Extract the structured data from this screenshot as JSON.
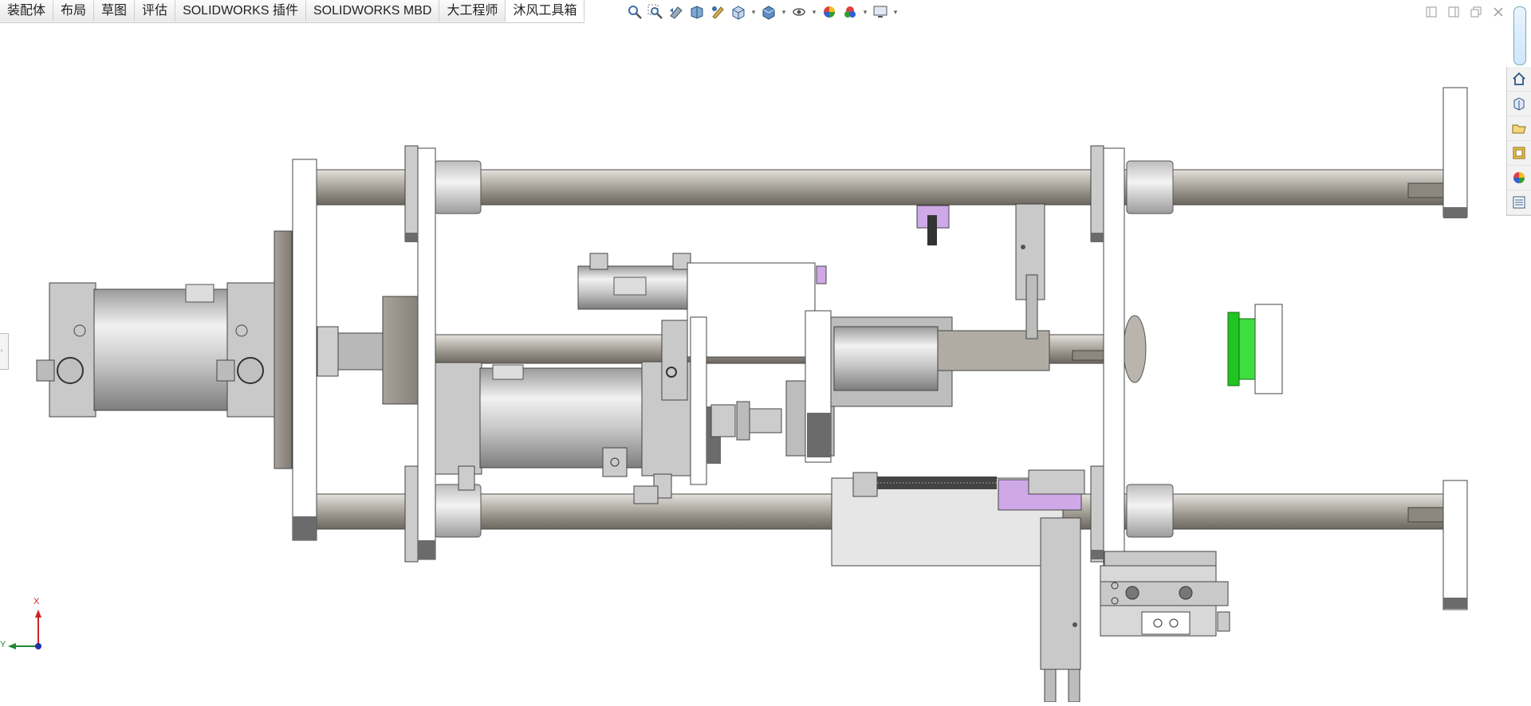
{
  "command_manager": {
    "tabs": [
      {
        "label": "装配体"
      },
      {
        "label": "布局"
      },
      {
        "label": "草图"
      },
      {
        "label": "评估"
      },
      {
        "label": "SOLIDWORKS 插件"
      },
      {
        "label": "SOLIDWORKS MBD"
      },
      {
        "label": "大工程师"
      },
      {
        "label": "沐风工具箱"
      }
    ],
    "active_tab": "沐风工具箱"
  },
  "heads_up_toolbar": {
    "icons": [
      "zoom-to-fit-icon",
      "zoom-to-area-icon",
      "previous-view-icon",
      "section-view-icon",
      "dynamic-annotation-icon",
      "view-orientation-icon",
      "display-style-icon",
      "hide-show-items-icon",
      "edit-appearance-icon",
      "apply-scene-icon",
      "view-settings-icon"
    ]
  },
  "window_controls": {
    "icons": [
      "tile-left-icon",
      "tile-right-icon",
      "restore-icon",
      "close-icon"
    ]
  },
  "task_pane": {
    "icons": [
      "home-icon",
      "design-library-icon",
      "file-explorer-icon",
      "view-palette-icon",
      "appearances-icon",
      "custom-properties-icon"
    ]
  },
  "triad": {
    "x_label": "X",
    "y_label": "Y",
    "colors": {
      "x": "#cc2222",
      "y": "#228833",
      "z": "#2233aa"
    }
  },
  "colors": {
    "background": "#ffffff",
    "rod": "#9e9a92",
    "plate": "#ffffff",
    "cylinder": "#c8c8c8",
    "accent_purple": "#cfa8e8",
    "accent_green": "#22c422"
  }
}
